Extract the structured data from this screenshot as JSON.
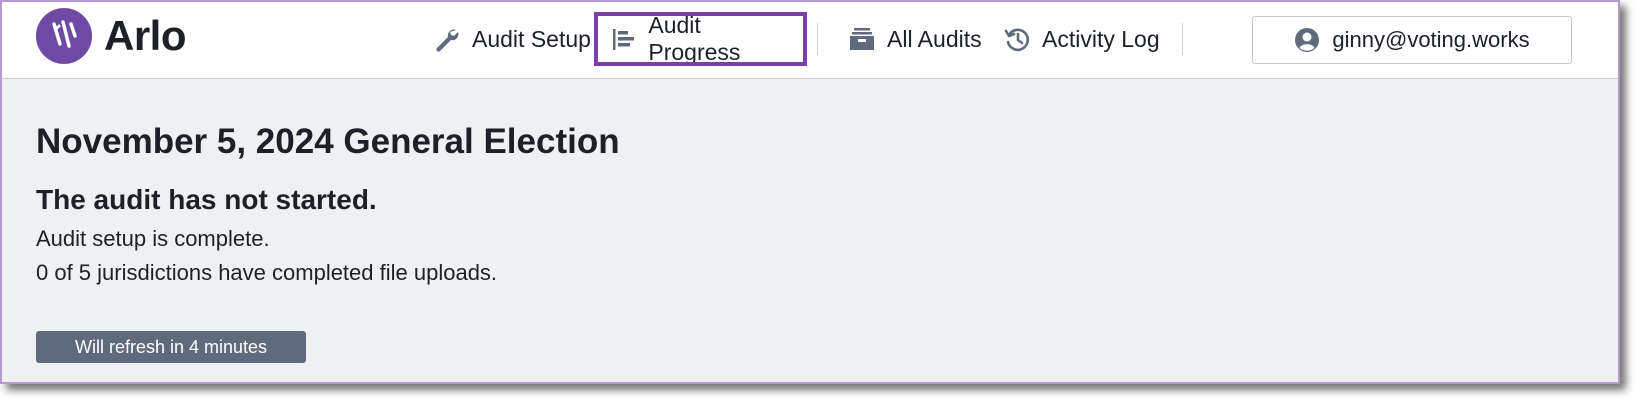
{
  "app": {
    "name": "Arlo"
  },
  "nav": {
    "items": [
      {
        "label": "Audit Setup",
        "icon": "wrench-icon",
        "active": false
      },
      {
        "label": "Audit Progress",
        "icon": "horizontal-bar-chart-icon",
        "active": true
      },
      {
        "label": "All Audits",
        "icon": "archive-icon",
        "active": false
      },
      {
        "label": "Activity Log",
        "icon": "history-icon",
        "active": false
      }
    ],
    "user": {
      "email": "ginny@voting.works",
      "icon": "user-icon"
    }
  },
  "main": {
    "election_title": "November 5, 2024 General Election",
    "status_heading": "The audit has not started.",
    "status_lines": [
      "Audit setup is complete.",
      "0 of 5 jurisdictions have completed file uploads."
    ],
    "refresh_label": "Will refresh in 4 minutes"
  },
  "colors": {
    "brand": "#6e4aa5",
    "active_outline": "#7a3fa6",
    "text": "#1c2127",
    "background": "#eef0f2",
    "badge": "#5f6b7c"
  }
}
